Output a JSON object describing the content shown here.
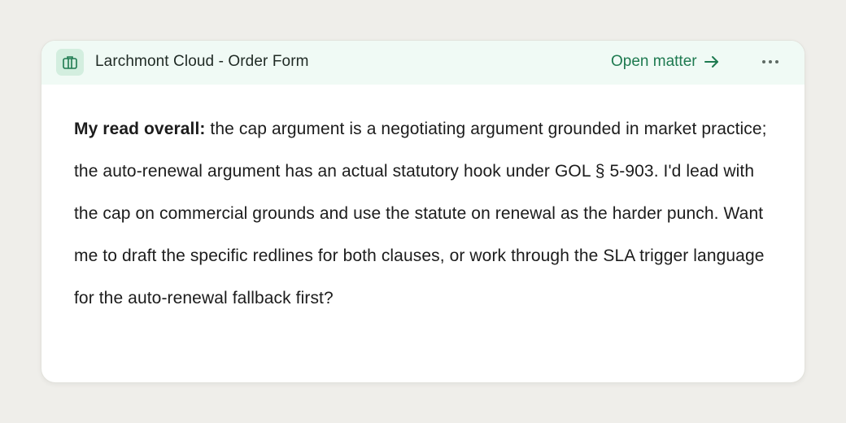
{
  "header": {
    "title": "Larchmont Cloud - Order Form",
    "icon": "document-icon",
    "open_matter_label": "Open matter",
    "open_matter_icon": "arrow-right-icon",
    "more_icon": "more-icon"
  },
  "message": {
    "lead": "My read overall:",
    "body": " the cap argument is a negotiating argument grounded in market practice; the auto-renewal argument has an actual statutory hook under GOL § 5-903. I'd lead with the cap on commercial grounds and use the statute on renewal as the harder punch. Want me to draft the specific redlines for both clauses, or work through the SLA trigger language for the auto-renewal fallback first?"
  },
  "colors": {
    "accent": "#1e7a50",
    "header_bg": "#f0faf5",
    "icon_bg": "#d3eedf",
    "page_bg": "#efeeea"
  }
}
